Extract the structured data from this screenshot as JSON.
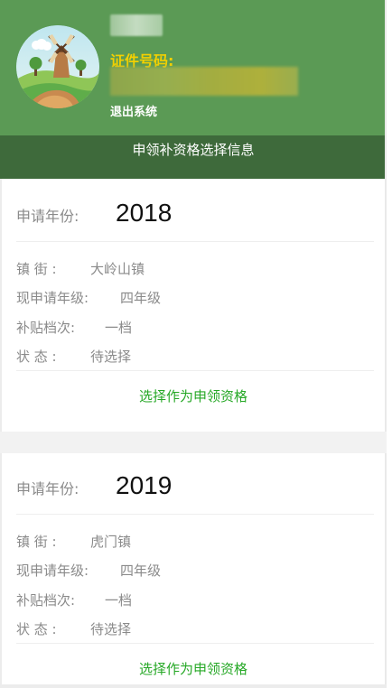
{
  "header": {
    "id_label": "证件号码:",
    "logout_label": "退出系统"
  },
  "title_bar": {
    "title": "申领补资格选择信息"
  },
  "cards": [
    {
      "year_label": "申请年份:",
      "year_value": "2018",
      "town_label": "镇 街 :",
      "town_value": "大岭山镇",
      "grade_label": "现申请年级:",
      "grade_value": "四年级",
      "level_label": "补贴档次:",
      "level_value": "一档",
      "status_label": "状 态 :",
      "status_value": "待选择",
      "action_label": "选择作为申领资格"
    },
    {
      "year_label": "申请年份:",
      "year_value": "2019",
      "town_label": "镇 街 :",
      "town_value": "虎门镇",
      "grade_label": "现申请年级:",
      "grade_value": "四年级",
      "level_label": "补贴档次:",
      "level_value": "一档",
      "status_label": "状 态 :",
      "status_value": "待选择",
      "action_label": "选择作为申领资格"
    }
  ],
  "colors": {
    "header_green": "#5b9a55",
    "title_bar_green": "#3e6a3b",
    "id_label_yellow": "#f3d000",
    "action_green": "#26a826"
  },
  "icons": {
    "avatar": "windmill-landscape-avatar-icon"
  }
}
